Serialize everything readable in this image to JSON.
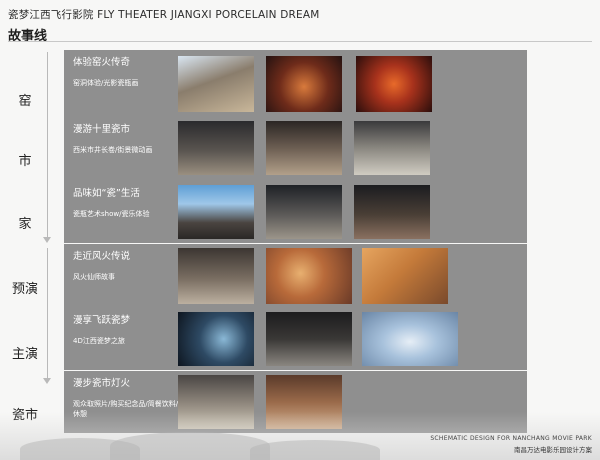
{
  "header": {
    "title": "瓷梦江西飞行影院 FLY THEATER JIANGXI PORCELAIN DREAM",
    "subtitle": "故事线"
  },
  "left_labels": [
    "窑",
    "市",
    "家",
    "预演",
    "主演",
    "瓷市"
  ],
  "rows": [
    {
      "title": "体验窑火传奇",
      "desc": "窑洞体验/光影瓷瓶画",
      "images": [
        "kiln-gallery-photo",
        "kiln-tunnel-red-photo",
        "kiln-fire-red-photo"
      ]
    },
    {
      "title": "漫游十里瓷市",
      "desc": "西米市井长卷/街景微动画",
      "images": [
        "market-street-photo",
        "market-lanterns-photo",
        "market-gate-photo"
      ]
    },
    {
      "title": "品味如“瓷”生活",
      "desc": "瓷瓶艺术show/瓷乐体验",
      "images": [
        "courtyard-blue-sky-photo",
        "courtyard-hall-photo",
        "courtyard-night-photo"
      ]
    },
    {
      "title": "走近风火传说",
      "desc": "风火仙师故事",
      "images": [
        "exhibit-room-photo",
        "fire-legend-painting",
        "craftsmen-illustration"
      ]
    },
    {
      "title": "漫享飞跃瓷梦",
      "desc": "4D江西瓷梦之旅",
      "images": [
        "dome-theater-photo",
        "porcelain-display-photo",
        "flying-theater-render"
      ]
    },
    {
      "title": "漫步瓷市灯火",
      "desc": "观众取照片/购买纪念品/简餐饮料/休憩",
      "images": [
        "shop-street-photo",
        "lantern-street-photo"
      ]
    }
  ],
  "footer": {
    "en": "SCHEMATIC DESIGN FOR NANCHANG MOVIE PARK",
    "cn": "南昌万达电影乐园设计方案"
  }
}
